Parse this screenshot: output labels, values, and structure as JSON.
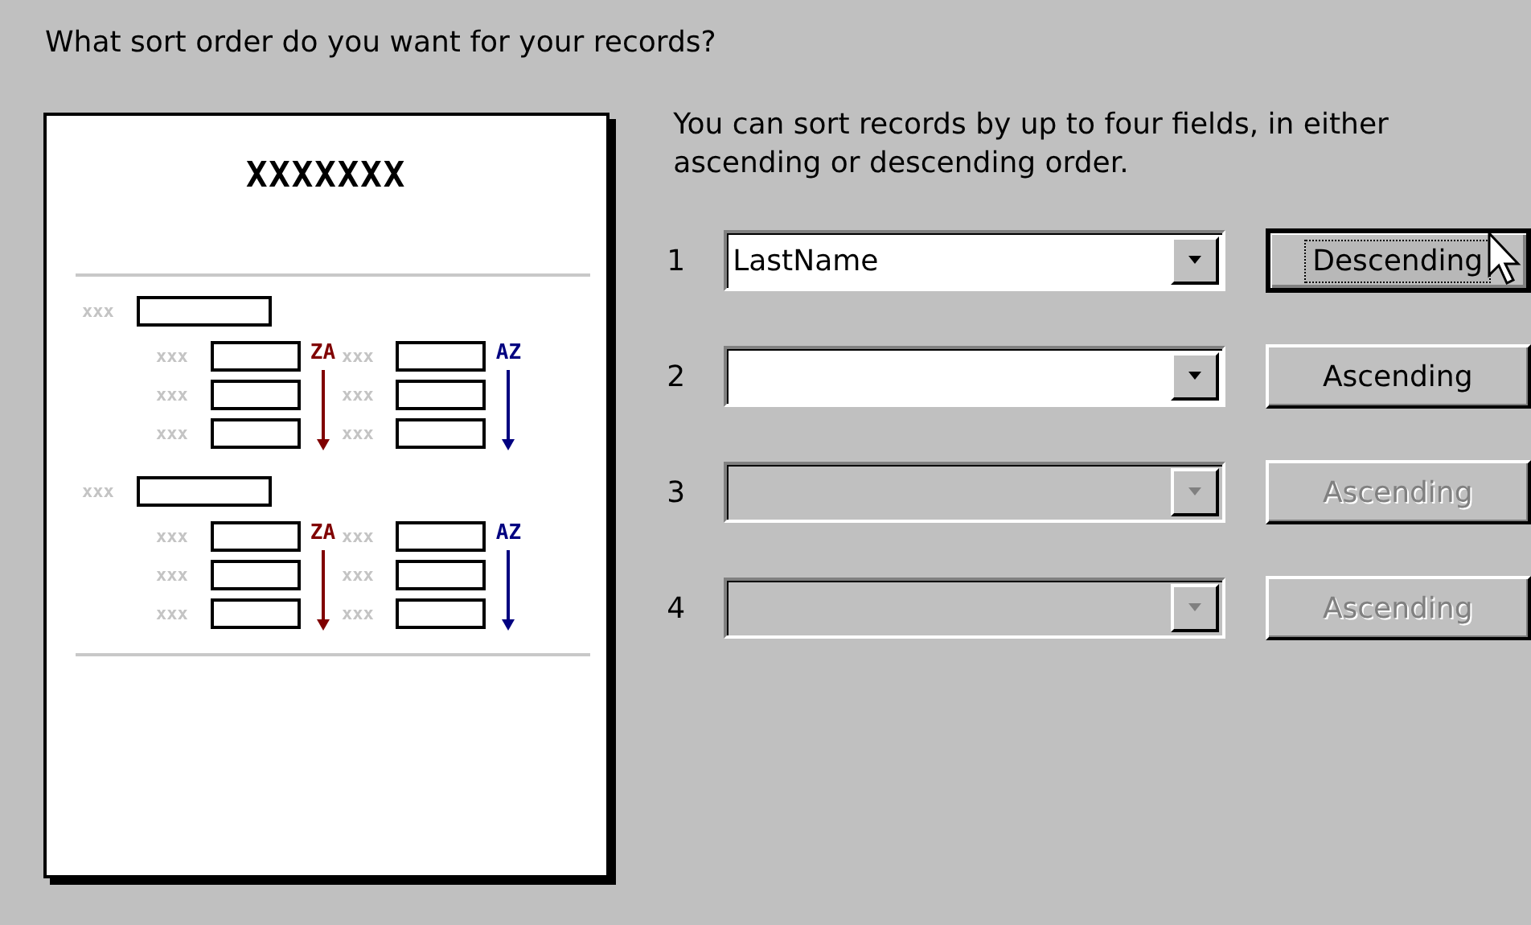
{
  "question": "What sort order do you want for your records?",
  "preview": {
    "title": "XXXXXXX",
    "groups": [
      {
        "label": "xxx",
        "columns": [
          {
            "kind": "descending",
            "sort_label": "ZA",
            "labels": [
              "xxx",
              "xxx",
              "xxx"
            ]
          },
          {
            "kind": "ascending",
            "sort_label": "AZ",
            "labels": [
              "xxx",
              "xxx",
              "xxx"
            ]
          }
        ]
      },
      {
        "label": "xxx",
        "columns": [
          {
            "kind": "descending",
            "sort_label": "ZA",
            "labels": [
              "xxx",
              "xxx",
              "xxx"
            ]
          },
          {
            "kind": "ascending",
            "sort_label": "AZ",
            "labels": [
              "xxx",
              "xxx",
              "xxx"
            ]
          }
        ]
      }
    ]
  },
  "description": "You can sort records by up to four fields, in either ascending or descending order.",
  "sort_fields": [
    {
      "number": "1",
      "value": "LastName",
      "disabled": false,
      "button": "Descending",
      "focused": true
    },
    {
      "number": "2",
      "disabled": false,
      "button": "Ascending",
      "focused": false
    },
    {
      "number": "3",
      "disabled": true,
      "button": "Ascending",
      "focused": false
    },
    {
      "number": "4",
      "disabled": true,
      "button": "Ascending",
      "focused": false
    }
  ]
}
